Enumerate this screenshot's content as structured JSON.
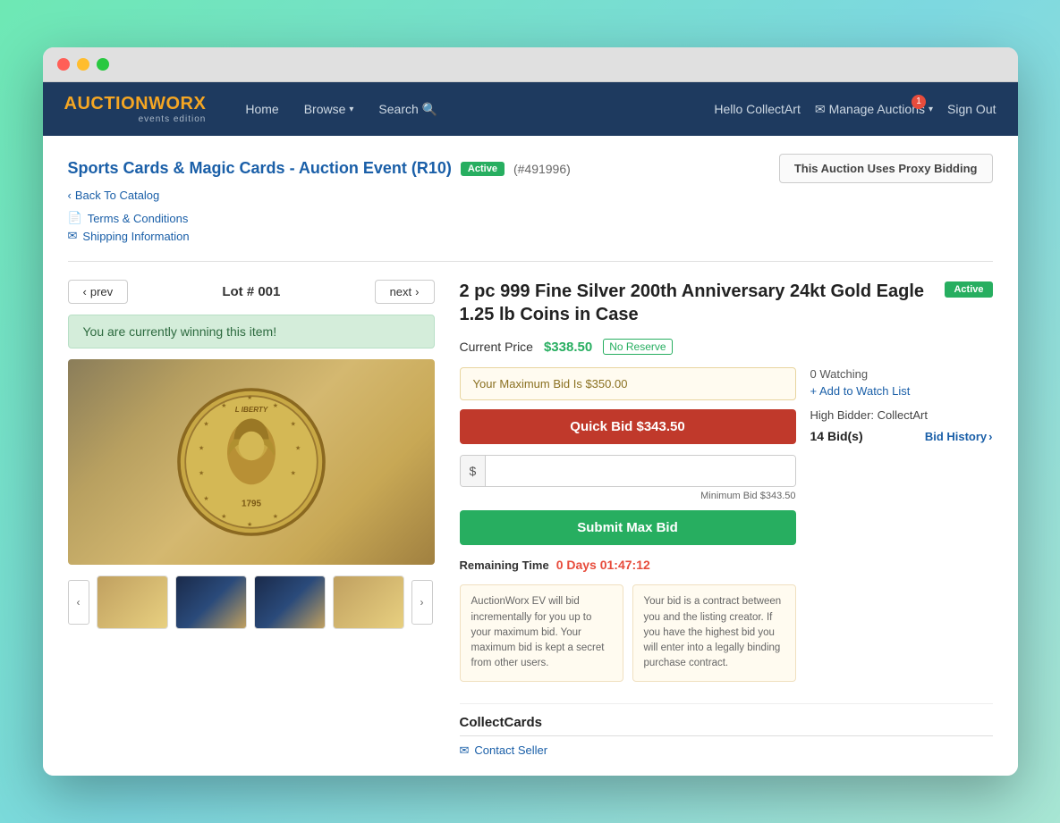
{
  "browser": {
    "dots": [
      "red",
      "yellow",
      "green"
    ]
  },
  "navbar": {
    "brand": "AUCTION",
    "brand_highlight": "WORX",
    "brand_sub": "events edition",
    "home": "Home",
    "browse": "Browse",
    "search": "Search",
    "hello": "Hello CollectArt",
    "manage": "Manage Auctions",
    "manage_badge": "1",
    "signout": "Sign Out"
  },
  "auction": {
    "title": "Sports Cards & Magic Cards - Auction Event (R10)",
    "status": "Active",
    "id": "(#491996)",
    "proxy_label": "This Auction Uses",
    "proxy_type": "Proxy Bidding",
    "back": "Back To Catalog",
    "terms": "Terms & Conditions",
    "shipping": "Shipping Information"
  },
  "lot": {
    "prev": "prev",
    "number": "Lot # 001",
    "next": "next",
    "winning_msg": "You are currently winning this item!"
  },
  "item": {
    "title": "2 pc 999 Fine Silver 200th Anniversary 24kt Gold Eagle 1.25 lb Coins in Case",
    "status": "Active",
    "current_price_label": "Current Price",
    "current_price": "$338.50",
    "no_reserve": "No Reserve",
    "max_bid_label": "Your Maximum Bid Is $350.00",
    "quick_bid_label": "Quick Bid $343.50",
    "dollar_sign": "$",
    "bid_placeholder": "",
    "min_bid": "Minimum Bid $343.50",
    "submit_label": "Submit Max Bid",
    "remaining_label": "Remaining Time",
    "remaining_time": "0 Days 01:47:12",
    "info1": "AuctionWorx EV will bid incrementally for you up to your maximum bid. Your maximum bid is kept a secret from other users.",
    "info2": "Your bid is a contract between you and the listing creator. If you have the highest bid you will enter into a legally binding purchase contract."
  },
  "sidebar": {
    "watch_count": "0 Watching",
    "add_watch": "+ Add to Watch List",
    "high_bidder_label": "High Bidder: CollectArt",
    "bids_count": "14 Bid(s)",
    "bid_history": "Bid History",
    "seller_name": "CollectCards",
    "contact": "Contact Seller"
  }
}
